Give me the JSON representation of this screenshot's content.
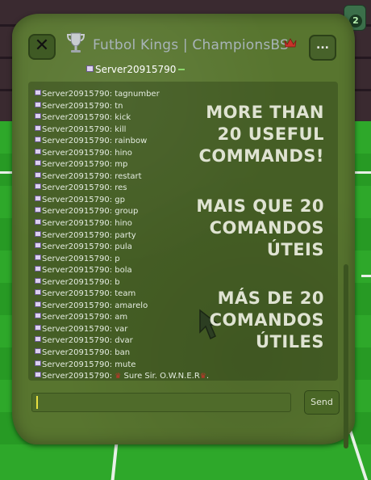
{
  "window": {
    "title": "Futbol Kings | ChampionsBS",
    "menu_label": "...",
    "close_label": "✕"
  },
  "badge": {
    "count": "2"
  },
  "server_tag": "Server20915790",
  "chat": {
    "messages": [
      {
        "sender": "Server20915790:",
        "text": "tagnumber"
      },
      {
        "sender": "Server20915790:",
        "text": "tn"
      },
      {
        "sender": "Server20915790:",
        "text": "kick"
      },
      {
        "sender": "Server20915790:",
        "text": "kill"
      },
      {
        "sender": "Server20915790:",
        "text": "rainbow"
      },
      {
        "sender": "Server20915790:",
        "text": "hino"
      },
      {
        "sender": "Server20915790:",
        "text": "mp"
      },
      {
        "sender": "Server20915790:",
        "text": "restart"
      },
      {
        "sender": "Server20915790:",
        "text": "res"
      },
      {
        "sender": "Server20915790:",
        "text": "gp"
      },
      {
        "sender": "Server20915790:",
        "text": "group"
      },
      {
        "sender": "Server20915790:",
        "text": "hino"
      },
      {
        "sender": "Server20915790:",
        "text": "party"
      },
      {
        "sender": "Server20915790:",
        "text": "pula"
      },
      {
        "sender": "Server20915790:",
        "text": "p"
      },
      {
        "sender": "Server20915790:",
        "text": "bola"
      },
      {
        "sender": "Server20915790:",
        "text": "b"
      },
      {
        "sender": "Server20915790:",
        "text": "team"
      },
      {
        "sender": "Server20915790:",
        "text": "amarelo"
      },
      {
        "sender": "Server20915790:",
        "text": "am"
      },
      {
        "sender": "Server20915790:",
        "text": "var"
      },
      {
        "sender": "Server20915790:",
        "text": "dvar"
      },
      {
        "sender": "Server20915790:",
        "text": "ban"
      },
      {
        "sender": "Server20915790:",
        "text": "mute"
      }
    ],
    "last_message": {
      "sender": "Server20915790:",
      "text": "Sure Sir. O.W.N.E.R"
    }
  },
  "promo": {
    "english": [
      "MORE THAN",
      "20 USEFUL",
      "COMMANDS!"
    ],
    "portuguese": [
      "MAIS QUE 20",
      "COMANDOS",
      "ÚTEIS"
    ],
    "spanish": [
      "MÁS DE 20",
      "COMANDOS",
      "ÚTILES"
    ]
  },
  "input": {
    "value": "",
    "placeholder": ""
  },
  "send_label": "Send",
  "colors": {
    "panel": "#58752f",
    "crown": "#c8322a",
    "field": "#2ea82a",
    "caret": "#e8e040"
  },
  "icons": [
    "close-icon",
    "trophy-icon",
    "crown-icon",
    "flag-icon",
    "cursor-icon",
    "more-icon"
  ]
}
